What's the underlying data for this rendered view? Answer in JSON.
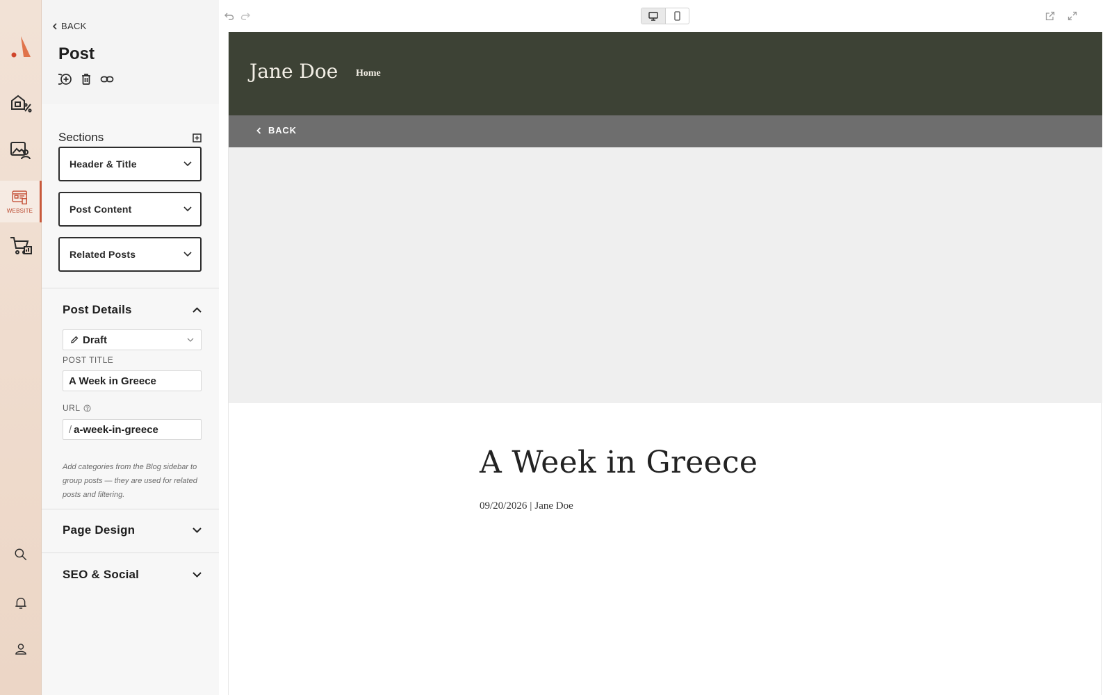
{
  "rail": {
    "items": [
      {
        "icon": "store-discount-icon"
      },
      {
        "icon": "media-library-icon"
      },
      {
        "icon": "website-icon",
        "label": "WEBSITE"
      },
      {
        "icon": "commerce-cart-icon"
      },
      {
        "icon": "search-icon"
      },
      {
        "icon": "bell-icon"
      },
      {
        "icon": "user-icon"
      }
    ]
  },
  "panel": {
    "back_label": "BACK",
    "title": "Post",
    "sections_label": "Sections",
    "sections": [
      {
        "label": "Header & Title"
      },
      {
        "label": "Post Content"
      },
      {
        "label": "Related Posts"
      }
    ],
    "post_details": {
      "label": "Post Details",
      "status": "Draft",
      "post_title_label": "POST TITLE",
      "post_title_value": "A Week in Greece",
      "url_label": "URL",
      "url_prefix": "/",
      "url_value": "a-week-in-greece",
      "helper_text": "Add categories from the Blog sidebar to group posts — they are used for related posts and filtering."
    },
    "page_design_label": "Page Design",
    "seo_label": "SEO & Social"
  },
  "site": {
    "name": "Jane Doe",
    "nav_home": "Home",
    "back_label": "BACK",
    "article_title": "A Week in Greece",
    "article_date": "09/20/2026",
    "article_sep": "|",
    "article_author": "Jane Doe"
  },
  "colors": {
    "accent": "#c85a3c",
    "site_header": "#3d4235",
    "site_back_bar": "#6e6e6e",
    "hero": "#efefef"
  }
}
